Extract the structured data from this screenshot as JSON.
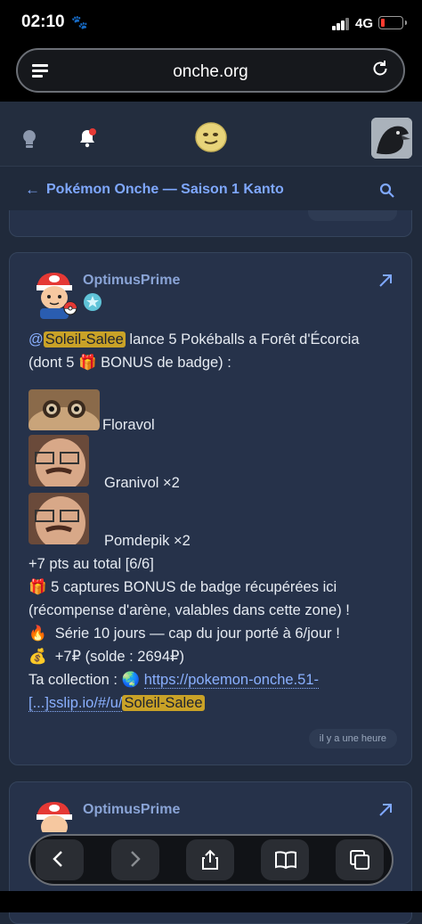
{
  "status": {
    "time": "02:10",
    "network": "4G"
  },
  "browser": {
    "url": "onche.org"
  },
  "topic": {
    "title": "Pokémon Onche — Saison 1 Kanto"
  },
  "post": {
    "author": "OptimusPrime",
    "mention_prefix": "@",
    "mention_name": "Soleil-Salee",
    "line1_rest": " lance 5 Pokéballs a Forêt d'Écorcia",
    "line2_a": "(dont 5 ",
    "line2_b": " BONUS de badge) :",
    "catches": [
      {
        "name": "Floravol"
      },
      {
        "name": "Granivol ×2"
      },
      {
        "name": "Pomdepik ×2"
      }
    ],
    "total": "+7 pts au total [6/6]",
    "bonus_line1": "5 captures BONUS de badge récupérées ici",
    "bonus_line2": "(récompense d'arène, valables dans cette zone) !",
    "streak": "Série 10 jours — cap du jour porté à 6/jour !",
    "money": "+7₽ (solde : 2694₽)",
    "collection_label": "Ta collection : ",
    "link_part1": "https://pokemon-onche.51-",
    "link_part2": "[...]sslip.io/#/u/",
    "link_name": "Soleil-Salee",
    "time": "il y a une heure"
  },
  "post2": {
    "author": "OptimusPrime"
  },
  "icons": {
    "gift": "🎁",
    "fire": "🔥",
    "moneybag": "💰",
    "globe": "🌏"
  }
}
